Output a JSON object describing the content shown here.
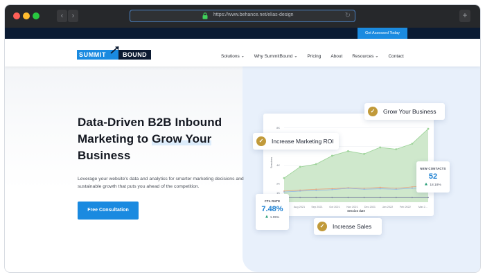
{
  "browser": {
    "url": "https://www.behance.net/elias-design",
    "back_glyph": "‹",
    "forward_glyph": "›",
    "newtab_glyph": "+",
    "reload_glyph": "↻"
  },
  "topbar": {
    "cta_label": "Get Assessed Today"
  },
  "brand": {
    "name_left": "SUMMIT",
    "name_right": "BOUND",
    "color_primary": "#1a8ae0",
    "color_dark": "#0c1a31",
    "color_gold": "#c19a3a"
  },
  "nav": {
    "items": [
      {
        "label": "Solutions",
        "has_dropdown": true
      },
      {
        "label": "Why SummitBound",
        "has_dropdown": true
      },
      {
        "label": "Pricing",
        "has_dropdown": false
      },
      {
        "label": "About",
        "has_dropdown": false
      },
      {
        "label": "Resources",
        "has_dropdown": true
      },
      {
        "label": "Contact",
        "has_dropdown": false
      }
    ],
    "dropdown_glyph": "⌄"
  },
  "hero": {
    "headline_line1": "Data-Driven B2B Inbound",
    "headline_line2a": "Marketing to ",
    "headline_line2b": "Grow Your",
    "headline_line3": "Business",
    "subtext": "Leverage your website's data and analytics for smarter marketing decisions and sustainable growth that puts you ahead of the competition.",
    "cta_label": "Free Consultation"
  },
  "callouts": {
    "grow": "Grow Your Business",
    "roi": "Increase Marketing ROI",
    "sales": "Increase Sales",
    "check_glyph": "✓"
  },
  "stats": {
    "cta_rate": {
      "label": "CTA RATE",
      "value": "7.48%",
      "delta": "1.05%"
    },
    "new_contacts": {
      "label": "NEW CONTACTS",
      "value": "52",
      "delta": "18.18%"
    }
  },
  "chart_data": {
    "type": "area",
    "xlabel": "Session date",
    "ylabel": "Sessions",
    "categories": [
      "Aug 2021",
      "Sep 2021",
      "Oct 2021",
      "Nov 2021",
      "Dec 2021",
      "Jan 2022",
      "Feb 2022",
      "Mar 2..."
    ],
    "y_ticks": [
      "1K",
      "2K",
      "4K",
      "6K",
      "8K"
    ],
    "series": [
      {
        "values": [
          2.6,
          3.8,
          4.1,
          5.0,
          5.5,
          5.2,
          5.9,
          5.7,
          6.3,
          7.9
        ]
      },
      {
        "values": [
          1.2,
          1.3,
          1.4,
          1.45,
          1.55,
          1.5,
          1.6,
          1.5,
          1.65,
          1.8
        ]
      },
      {
        "values": [
          1.1,
          1.2,
          1.25,
          1.35,
          1.5,
          1.4,
          1.45,
          1.4,
          1.5,
          1.55
        ]
      },
      {
        "values": [
          0.5,
          0.5,
          0.5,
          0.5,
          0.5,
          0.5,
          0.5,
          0.5,
          0.5,
          0.5
        ]
      }
    ],
    "colors": [
      "#9ed49a",
      "#e7a07b",
      "#8fb4e3",
      "#7a7fa0"
    ]
  }
}
